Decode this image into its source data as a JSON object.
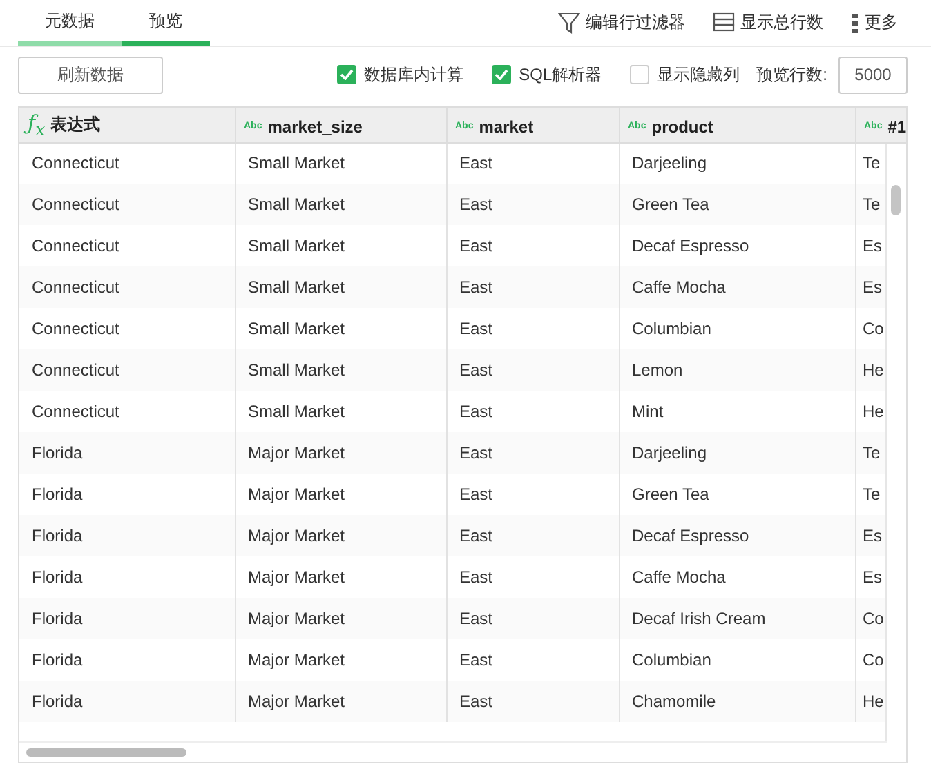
{
  "tabs": [
    {
      "label": "元数据",
      "selected": false
    },
    {
      "label": "预览",
      "selected": true
    }
  ],
  "actions": [
    {
      "kind": "filter",
      "label": "编辑行过滤器"
    },
    {
      "kind": "rows",
      "label": "显示总行数"
    },
    {
      "kind": "more",
      "label": "更多"
    }
  ],
  "refresh_button": "刷新数据",
  "options": [
    {
      "label": "数据库内计算",
      "checked": true
    },
    {
      "label": "SQL解析器",
      "checked": true
    },
    {
      "label": "显示隐藏列",
      "checked": false
    }
  ],
  "preview_rows": {
    "label": "预览行数:",
    "value": "5000"
  },
  "table": {
    "columns": [
      {
        "kind": "expression",
        "icon": "ƒ$_{x}$",
        "label": "表达式"
      },
      {
        "kind": "text",
        "icon": "Abc",
        "label": "market_size"
      },
      {
        "kind": "text",
        "icon": "Abc",
        "label": "market"
      },
      {
        "kind": "text",
        "icon": "Abc",
        "label": "product"
      },
      {
        "kind": "text",
        "icon": "Abc",
        "label": "#1"
      }
    ],
    "rows": [
      [
        "Connecticut",
        "Small Market",
        "East",
        "Darjeeling",
        "Te"
      ],
      [
        "Connecticut",
        "Small Market",
        "East",
        "Green Tea",
        "Te"
      ],
      [
        "Connecticut",
        "Small Market",
        "East",
        "Decaf Espresso",
        "Es"
      ],
      [
        "Connecticut",
        "Small Market",
        "East",
        "Caffe Mocha",
        "Es"
      ],
      [
        "Connecticut",
        "Small Market",
        "East",
        "Columbian",
        "Co"
      ],
      [
        "Connecticut",
        "Small Market",
        "East",
        "Lemon",
        "He"
      ],
      [
        "Connecticut",
        "Small Market",
        "East",
        "Mint",
        "He"
      ],
      [
        "Florida",
        "Major Market",
        "East",
        "Darjeeling",
        "Te"
      ],
      [
        "Florida",
        "Major Market",
        "East",
        "Green Tea",
        "Te"
      ],
      [
        "Florida",
        "Major Market",
        "East",
        "Decaf Espresso",
        "Es"
      ],
      [
        "Florida",
        "Major Market",
        "East",
        "Caffe Mocha",
        "Es"
      ],
      [
        "Florida",
        "Major Market",
        "East",
        "Decaf Irish Cream",
        "Co"
      ],
      [
        "Florida",
        "Major Market",
        "East",
        "Columbian",
        "Co"
      ],
      [
        "Florida",
        "Major Market",
        "East",
        "Chamomile",
        "He"
      ]
    ]
  }
}
